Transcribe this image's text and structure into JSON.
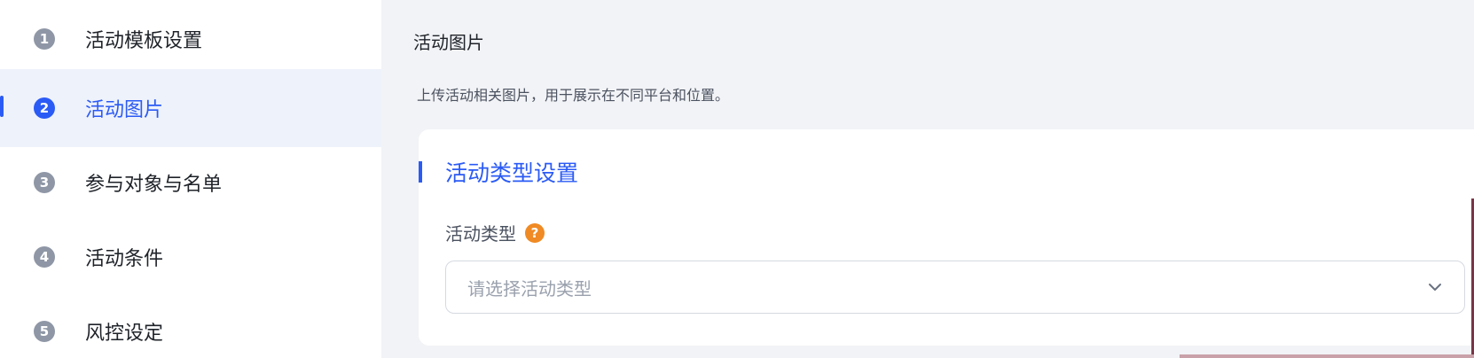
{
  "steps": [
    {
      "number": "1",
      "label": "活动模板设置"
    },
    {
      "number": "2",
      "label": "活动图片"
    },
    {
      "number": "3",
      "label": "参与对象与名单"
    },
    {
      "number": "4",
      "label": "活动条件"
    },
    {
      "number": "5",
      "label": "风控设定"
    }
  ],
  "active_step_index": 1,
  "main": {
    "page_title": "活动图片",
    "page_description": "上传活动相关图片，用于展示在不同平台和位置。",
    "section_title": "活动类型设置",
    "field_label": "活动类型",
    "help_icon": "question-circle-icon",
    "help_icon_glyph": "?",
    "select_placeholder": "请选择活动类型",
    "select_icon": "chevron-down-icon"
  },
  "colors": {
    "accent": "#2b5bf5",
    "help": "#f08a24",
    "main_bg": "#f2f3f6",
    "active_bg": "#eef2fb"
  }
}
